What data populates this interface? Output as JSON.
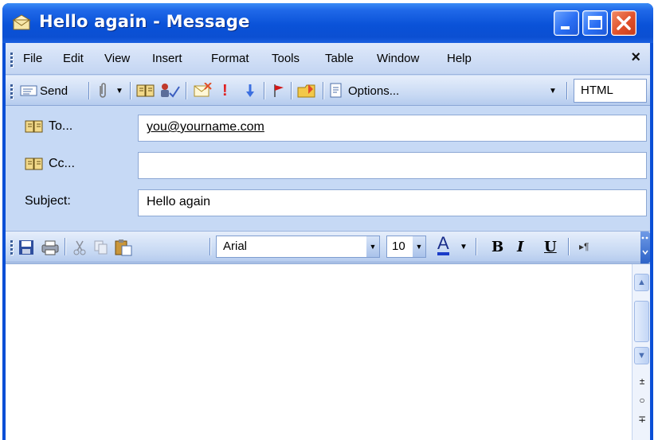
{
  "window": {
    "title": "Hello again - Message"
  },
  "menu": {
    "items": [
      "File",
      "Edit",
      "View",
      "Insert",
      "Format",
      "Tools",
      "Table",
      "Window",
      "Help"
    ],
    "close_glyph": "×"
  },
  "toolbar": {
    "send_label": "Send",
    "options_label": "Options...",
    "format_value": "HTML"
  },
  "fields": {
    "to_label": "To...",
    "to_value": "you@yourname.com",
    "cc_label": "Cc...",
    "cc_value": "",
    "subject_label": "Subject:",
    "subject_value": "Hello again"
  },
  "format_bar": {
    "font_name": "Arial",
    "font_size": "10",
    "bold": "B",
    "italic": "I",
    "underline": "U",
    "font_color_glyph": "A"
  },
  "colors": {
    "title_blue": "#0a52d8",
    "close_red": "#e0502a",
    "chrome": "#c6d9f5"
  },
  "icons": [
    "app-icon",
    "minimize-icon",
    "maximize-icon",
    "close-icon",
    "send-icon",
    "paperclip-icon",
    "address-book-icon",
    "check-names-icon",
    "importance-high-icon",
    "importance-low-icon",
    "follow-up-flag-icon",
    "save-icon",
    "print-icon",
    "cut-icon",
    "copy-icon",
    "paste-icon"
  ]
}
